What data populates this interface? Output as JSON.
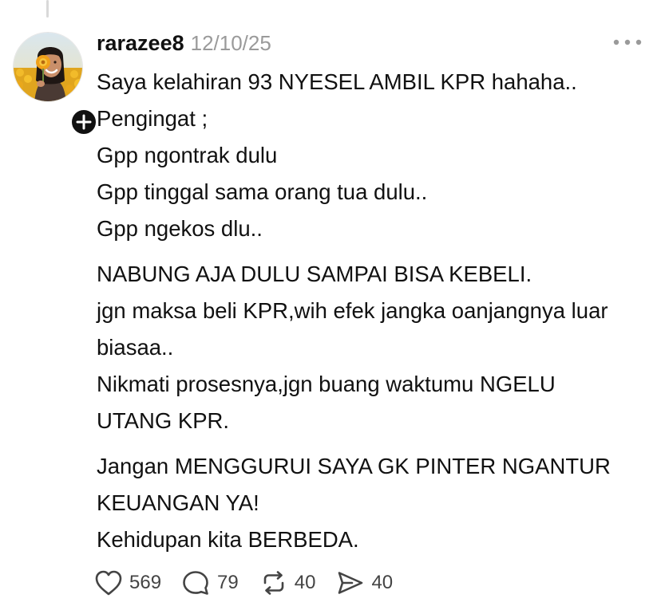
{
  "post": {
    "username": "rarazee8",
    "timestamp": "12/10/25",
    "more_icon": "more-horizontal-icon",
    "follow_icon": "plus-icon",
    "paragraphs": [
      [
        "Saya kelahiran 93 NYESEL AMBIL KPR hahaha..",
        "Pengingat ;",
        "Gpp ngontrak dulu",
        "Gpp tinggal sama orang tua dulu..",
        "Gpp ngekos dlu.."
      ],
      [
        "NABUNG AJA DULU SAMPAI BISA KEBELI.",
        "jgn maksa beli KPR,wih efek jangka oanjangnya luar biasaa..",
        "Nikmati prosesnya,jgn buang waktumu NGELU UTANG KPR."
      ],
      [
        "Jangan MENGGURUI SAYA GK PINTER NGANTUR KEUANGAN YA!",
        "Kehidupan kita BERBEDA."
      ]
    ]
  },
  "actions": {
    "like": {
      "icon": "heart-icon",
      "count": "569"
    },
    "reply": {
      "icon": "comment-bubble-icon",
      "count": "79"
    },
    "repost": {
      "icon": "repost-icon",
      "count": "40"
    },
    "share": {
      "icon": "send-icon",
      "count": "40"
    }
  },
  "colors": {
    "text": "#111111",
    "muted": "#9a9a9a",
    "action": "#444444",
    "thread_line": "#d9d9d9"
  }
}
